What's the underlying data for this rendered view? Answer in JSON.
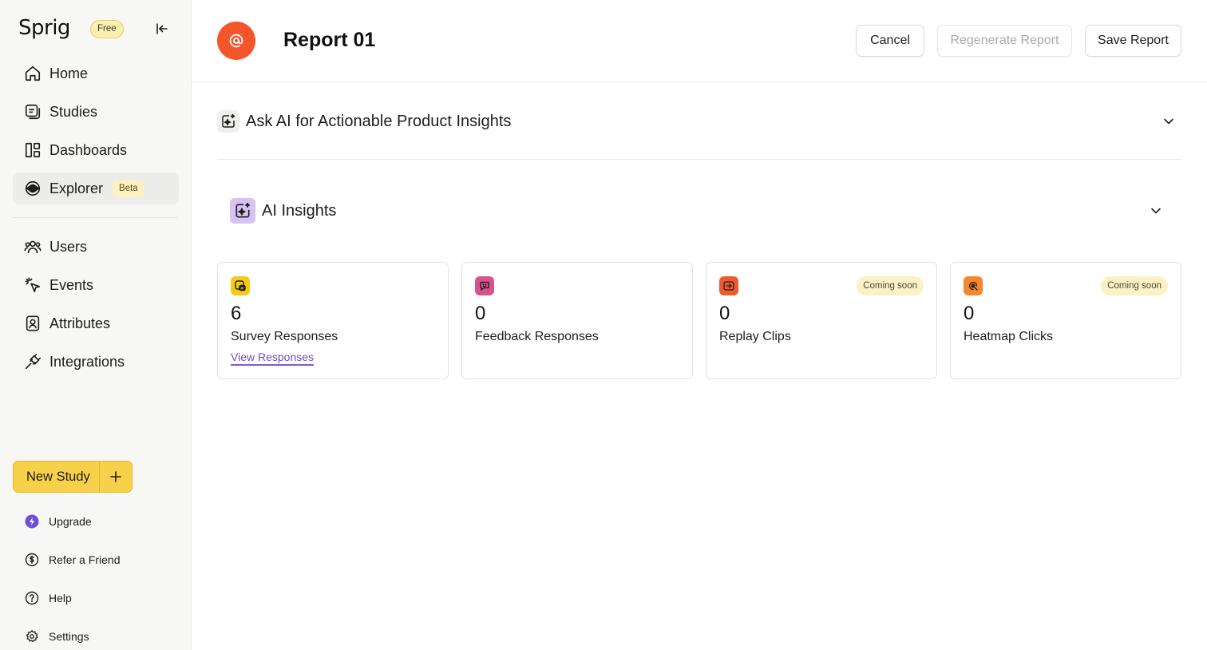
{
  "sidebar": {
    "brand": "Sprig",
    "plan_badge": "Free",
    "primary_nav": [
      {
        "label": "Home",
        "icon": "home-icon"
      },
      {
        "label": "Studies",
        "icon": "studies-icon"
      },
      {
        "label": "Dashboards",
        "icon": "dashboards-icon"
      },
      {
        "label": "Explorer",
        "icon": "explorer-icon",
        "badge": "Beta",
        "active": true
      }
    ],
    "secondary_nav": [
      {
        "label": "Users",
        "icon": "users-icon"
      },
      {
        "label": "Events",
        "icon": "events-icon"
      },
      {
        "label": "Attributes",
        "icon": "attributes-icon"
      },
      {
        "label": "Integrations",
        "icon": "integrations-icon"
      }
    ],
    "new_study_label": "New Study",
    "bottom_nav": [
      {
        "label": "Upgrade",
        "icon": "upgrade-icon"
      },
      {
        "label": "Refer a Friend",
        "icon": "refer-icon"
      },
      {
        "label": "Help",
        "icon": "help-icon"
      },
      {
        "label": "Settings",
        "icon": "settings-icon"
      }
    ]
  },
  "header": {
    "title": "Report 01",
    "cancel_label": "Cancel",
    "regenerate_label": "Regenerate Report",
    "save_label": "Save Report"
  },
  "ask_ai": {
    "title": "Ask AI for Actionable Product Insights"
  },
  "ai_insights": {
    "title": "AI Insights",
    "cards": [
      {
        "value": "6",
        "label": "Survey Responses",
        "link": "View Responses",
        "icon": "survey-icon",
        "icon_color": "#f6c915"
      },
      {
        "value": "0",
        "label": "Feedback Responses",
        "icon": "feedback-icon",
        "icon_color": "#d7548a"
      },
      {
        "value": "0",
        "label": "Replay Clips",
        "badge": "Coming soon",
        "icon": "replay-icon",
        "icon_color": "#ee5b2c"
      },
      {
        "value": "0",
        "label": "Heatmap Clicks",
        "badge": "Coming soon",
        "icon": "heatmap-icon",
        "icon_color": "#f6872a"
      }
    ]
  },
  "colors": {
    "accent_orange": "#f4552b",
    "primary_yellow": "#f8d14a",
    "link_purple": "#6b4fc4",
    "ai_purple": "#d9c1f3"
  }
}
